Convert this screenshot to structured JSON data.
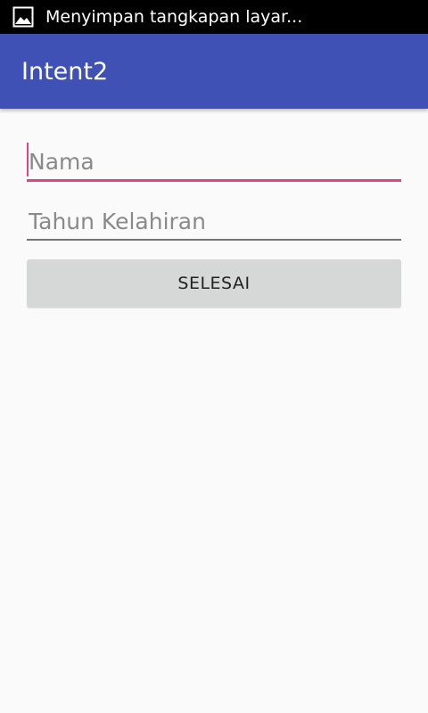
{
  "status_bar": {
    "icon": "image-icon",
    "notification_text": "Menyimpan tangkapan layar..."
  },
  "app_bar": {
    "title": "Intent2",
    "color": "#3f51b5"
  },
  "form": {
    "name_field": {
      "placeholder": "Nama",
      "value": ""
    },
    "birth_year_field": {
      "placeholder": "Tahun Kelahiran",
      "value": ""
    },
    "submit_label": "SELESAI",
    "accent_color": "#e4457e"
  }
}
